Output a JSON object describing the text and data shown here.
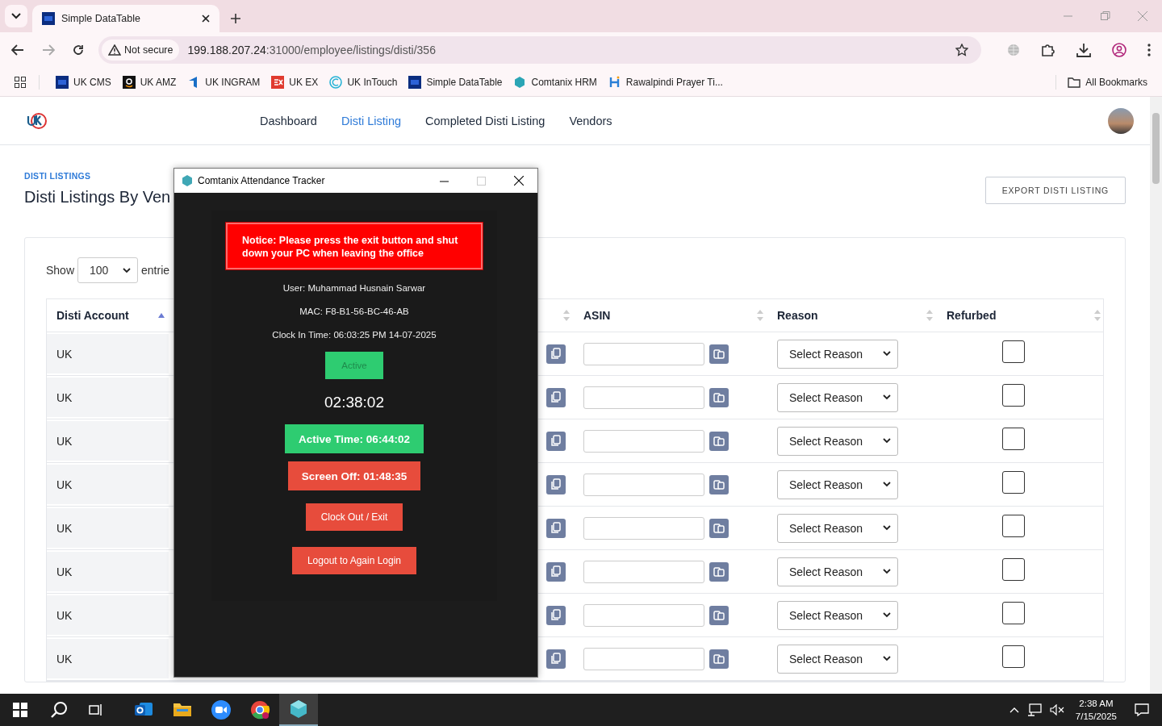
{
  "browser": {
    "tabs": [
      {
        "title": "Simple DataTable",
        "selected": true
      }
    ],
    "address": {
      "security": "Not secure",
      "host": "199.188.207.24",
      "path": ":31000/employee/listings/disti/356"
    },
    "bookmarks": [
      {
        "label": "UK CMS",
        "kind": "df"
      },
      {
        "label": "UK AMZ",
        "kind": "amz"
      },
      {
        "label": "UK INGRAM",
        "kind": "ingram"
      },
      {
        "label": "UK EX",
        "kind": "ex"
      },
      {
        "label": "UK InTouch",
        "kind": "intouch"
      },
      {
        "label": "Simple DataTable",
        "kind": "df"
      },
      {
        "label": "Comtanix HRM",
        "kind": "hex"
      },
      {
        "label": "Rawalpindi Prayer Ti...",
        "kind": "prayer"
      }
    ],
    "all_bookmarks": "All Bookmarks"
  },
  "nav": {
    "items": [
      {
        "label": "Dashboard",
        "selected": false
      },
      {
        "label": "Disti Listing",
        "selected": true
      },
      {
        "label": "Completed Disti Listing",
        "selected": false
      },
      {
        "label": "Vendors",
        "selected": false
      }
    ]
  },
  "page": {
    "eyebrow": "DISTI LISTINGS",
    "title": "Disti Listings By Ven",
    "export_button": "EXPORT DISTI LISTING",
    "length": {
      "label": "Show",
      "value": "100",
      "suffix": "entrie"
    },
    "table": {
      "columns": [
        {
          "label": "Disti Account",
          "sorted": true
        },
        {
          "sorted": false
        },
        {
          "label": "ASIN",
          "sorted": false
        },
        {
          "label": "Reason",
          "sorted": false
        },
        {
          "label": "Refurbed",
          "sorted": false
        }
      ],
      "rows": [
        {
          "disti_account": "UK",
          "reason": "Select Reason",
          "refurbed": false
        },
        {
          "disti_account": "UK",
          "reason": "Select Reason",
          "refurbed": false
        },
        {
          "disti_account": "UK",
          "reason": "Select Reason",
          "refurbed": false
        },
        {
          "disti_account": "UK",
          "reason": "Select Reason",
          "refurbed": false
        },
        {
          "disti_account": "UK",
          "reason": "Select Reason",
          "refurbed": false
        },
        {
          "disti_account": "UK",
          "reason": "Select Reason",
          "refurbed": false
        },
        {
          "disti_account": "UK",
          "reason": "Select Reason",
          "refurbed": false
        },
        {
          "disti_account": "UK",
          "reason": "Select Reason",
          "refurbed": false
        }
      ]
    }
  },
  "tracker": {
    "title": "Comtanix Attendance Tracker",
    "notice": "Notice: Please press the exit button and shut down your PC when leaving the office",
    "user": "User: Muhammad Husnain Sarwar",
    "mac": "MAC: F8-B1-56-BC-46-AB",
    "clock_in": "Clock In Time: 06:03:25 PM 14-07-2025",
    "status": "Active",
    "timer": "02:38:02",
    "active_time": "Active Time: 06:44:02",
    "screen_off": "Screen Off: 01:48:35",
    "buttons": [
      "Clock Out / Exit",
      "Logout to Again Login"
    ]
  },
  "taskbar": {
    "apps": [
      {
        "kind": "outlook",
        "selected": false
      },
      {
        "kind": "files",
        "selected": false
      },
      {
        "kind": "zoom",
        "selected": false
      },
      {
        "kind": "chrome",
        "selected": false
      },
      {
        "kind": "tracker",
        "selected": true
      }
    ],
    "time": "2:38 AM",
    "date": "7/15/2025"
  }
}
